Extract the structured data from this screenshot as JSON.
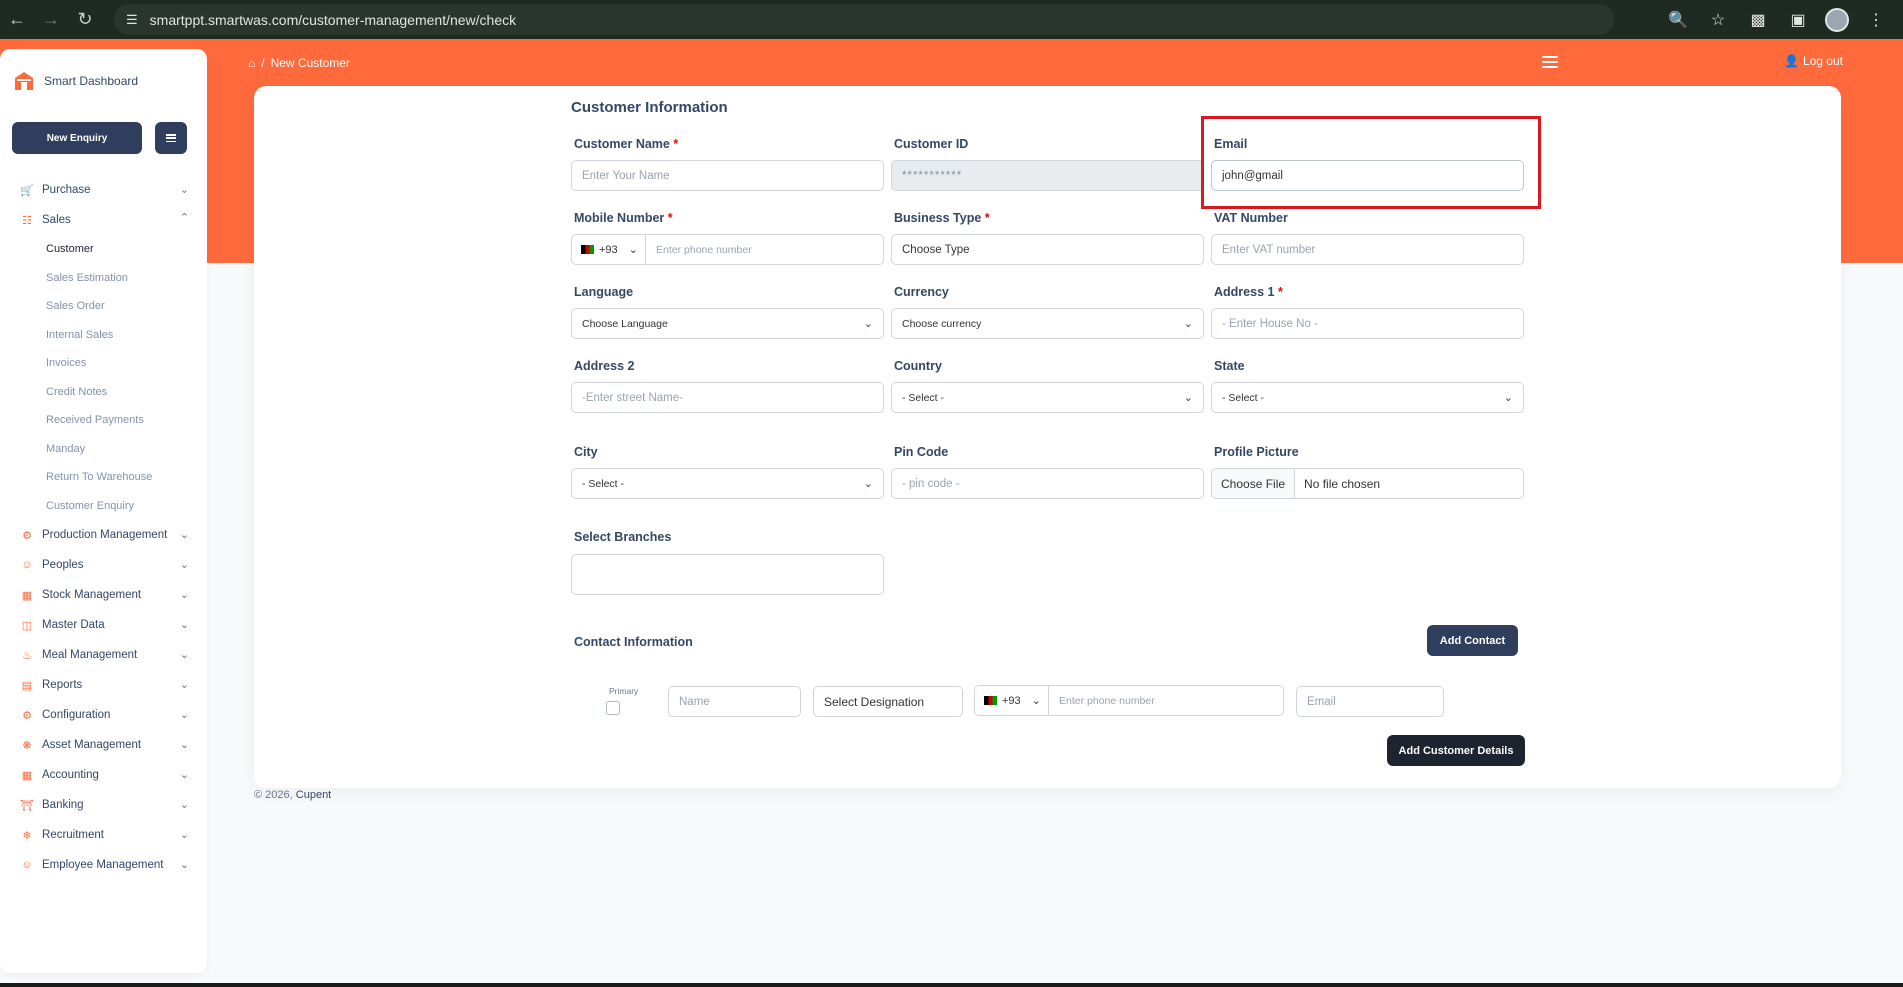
{
  "browser": {
    "url": "smartppt.smartwas.com/customer-management/new/check"
  },
  "header": {
    "breadcrumb_current": "New Customer",
    "logout_label": "Log out"
  },
  "sidebar": {
    "brand": "Smart Dashboard",
    "new_enquiry_label": "New Enquiry",
    "items": [
      {
        "label": "Purchase",
        "icon": "cart-icon",
        "expanded": false
      },
      {
        "label": "Sales",
        "icon": "sales-icon",
        "expanded": true
      }
    ],
    "sales_sub": [
      "Customer",
      "Sales Estimation",
      "Sales Order",
      "Internal Sales",
      "Invoices",
      "Credit Notes",
      "Received Payments",
      "Manday",
      "Return To Warehouse",
      "Customer Enquiry"
    ],
    "active_sub": "Customer",
    "more_items": [
      "Production Management",
      "Peoples",
      "Stock Management",
      "Master Data",
      "Meal Management",
      "Reports",
      "Configuration",
      "Asset Management",
      "Accounting",
      "Banking",
      "Recruitment",
      "Employee Management"
    ]
  },
  "form": {
    "title": "Customer Information",
    "customer_name": {
      "label": "Customer Name",
      "placeholder": "Enter Your Name"
    },
    "customer_id": {
      "label": "Customer ID",
      "value": "***********"
    },
    "email": {
      "label": "Email",
      "value": "john@gmail"
    },
    "mobile": {
      "label": "Mobile Number",
      "country_code": "+93",
      "placeholder": "Enter phone number"
    },
    "business_type": {
      "label": "Business Type",
      "value": "Choose Type"
    },
    "vat": {
      "label": "VAT Number",
      "placeholder": "Enter VAT number"
    },
    "language": {
      "label": "Language",
      "value": "Choose Language"
    },
    "currency": {
      "label": "Currency",
      "value": "Choose currency"
    },
    "address1": {
      "label": "Address 1",
      "placeholder": "- Enter House No -"
    },
    "address2": {
      "label": "Address 2",
      "placeholder": "-Enter street Name-"
    },
    "country": {
      "label": "Country",
      "value": "- Select -"
    },
    "state": {
      "label": "State",
      "value": "- Select -"
    },
    "city": {
      "label": "City",
      "value": "- Select -"
    },
    "pin_code": {
      "label": "Pin Code",
      "placeholder": "- pin code -"
    },
    "profile_picture": {
      "label": "Profile Picture",
      "button": "Choose File",
      "status": "No file chosen"
    },
    "branches": {
      "label": "Select Branches"
    }
  },
  "contact": {
    "title": "Contact Information",
    "add_contact_label": "Add Contact",
    "primary_label": "Primary",
    "name_placeholder": "Name",
    "designation_value": "Select Designation",
    "country_code": "+93",
    "phone_placeholder": "Enter phone number",
    "email_placeholder": "Email"
  },
  "submit_label": "Add Customer Details",
  "footer": {
    "copyright": "© 2026,",
    "company": "Cupent"
  },
  "colors": {
    "accent": "#ff6a3d",
    "primary_button": "#2f3e5d",
    "highlight_box": "#d9181f"
  }
}
